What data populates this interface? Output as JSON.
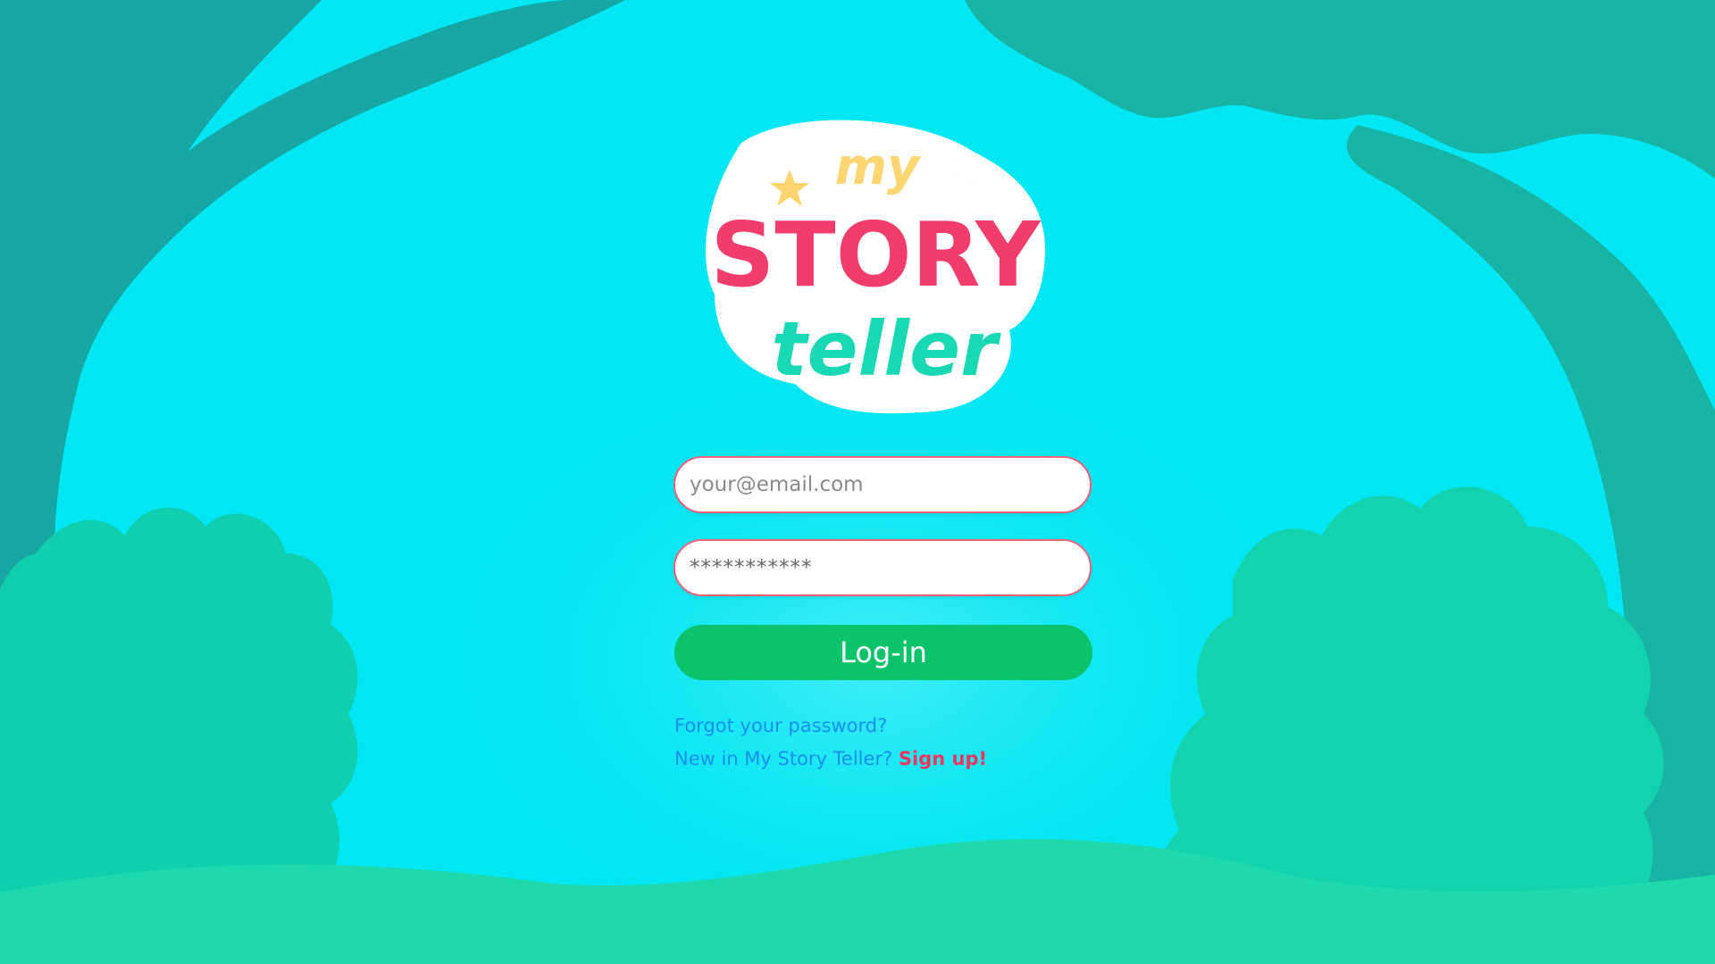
{
  "app": {
    "logo": {
      "line1": "my",
      "line2": "STORY",
      "line3": "teller",
      "colors": {
        "my": "#fdd672",
        "story": "#f23c6b",
        "teller": "#19d8b4",
        "outline": "#ffffff"
      }
    }
  },
  "login_form": {
    "email": {
      "placeholder": "your@email.com",
      "value": ""
    },
    "password": {
      "placeholder": "",
      "value": "***********"
    },
    "login_button_label": "Log-in",
    "forgot_password_label": "Forgot your password?",
    "signup_prompt": "New in My Story Teller?",
    "signup_link_label": "Sign up!"
  },
  "theme": {
    "sky": "#00e6f2",
    "trees": "#16a7a4",
    "bushes": "#0dd7ae",
    "ground": "#1dd9ab",
    "input_border": "#f0627a",
    "button": "#0ac36a",
    "link": "#1b8ff0",
    "signup_link": "#f0355e"
  },
  "icons": {
    "logo_star": "star-icon",
    "logo_moon": "moon-icon"
  }
}
